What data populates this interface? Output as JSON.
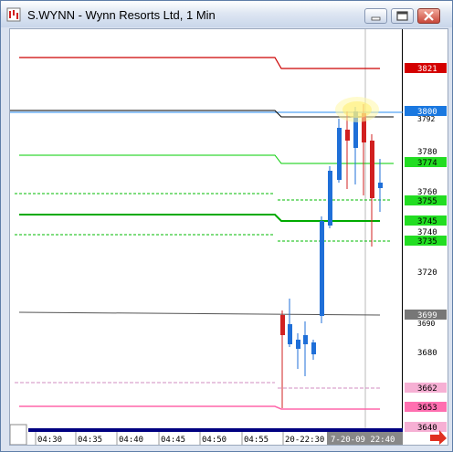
{
  "window": {
    "title": "S.WYNN - Wynn Resorts Ltd, 1 Min",
    "buttons": [
      "minimize",
      "maximize",
      "close"
    ]
  },
  "price_axis": {
    "labels": [
      "3821",
      "3800",
      "3792",
      "3780",
      "3774",
      "3760",
      "3755",
      "3745",
      "3740",
      "3735",
      "3720",
      "3699",
      "3690",
      "3680",
      "3662",
      "3653",
      "3640"
    ]
  },
  "time_axis": {
    "labels": [
      "04:30",
      "04:35",
      "04:40",
      "04:45",
      "04:50",
      "04:55",
      "20-22:30",
      "7-20-09 22:40"
    ]
  },
  "levels": [
    {
      "label": "3821",
      "color": "#cc0000"
    },
    {
      "label": "3800",
      "color": "#000000"
    },
    {
      "label": "3774",
      "color": "#00cc00"
    },
    {
      "label": "3755",
      "color": "#00cc00"
    },
    {
      "label": "3745",
      "color": "#00aa00"
    },
    {
      "label": "3735",
      "color": "#00cc00"
    },
    {
      "label": "3699",
      "color": "#555555"
    },
    {
      "label": "3662",
      "color": "#e0a0c8"
    },
    {
      "label": "3653",
      "color": "#ff66aa"
    }
  ],
  "colors": {
    "up_candle": "#1f6fd8",
    "down_candle": "#d12020",
    "label_bg_red": "#d40000",
    "label_bg_blue": "#1a78e0",
    "label_bg_green": "#22dd22"
  }
}
